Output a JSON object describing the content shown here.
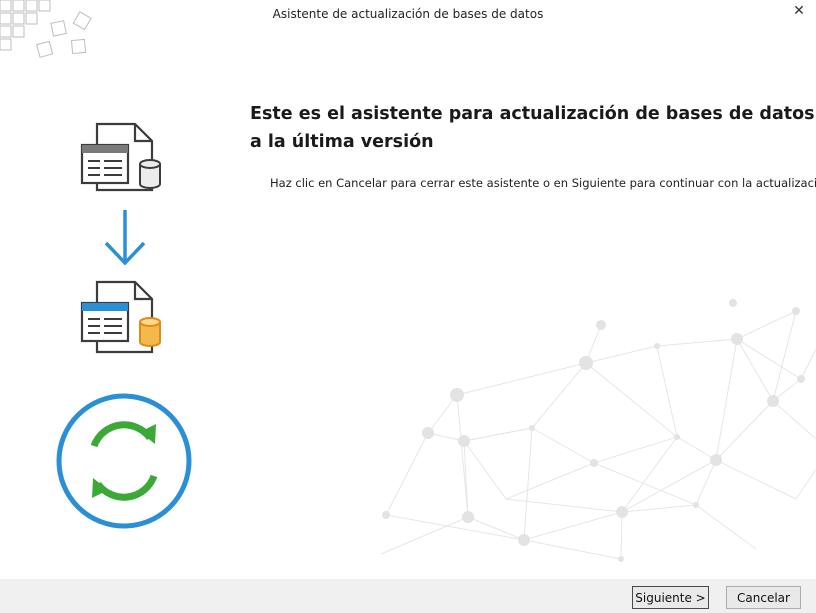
{
  "window": {
    "title": "Asistente de actualización de bases de datos",
    "close_symbol": "✕"
  },
  "content": {
    "heading_line1": "Este es el asistente para actualización de bases de datos",
    "heading_line2": "a la última versión",
    "instructions": "Haz clic en Cancelar para cerrar este asistente o en Siguiente para continuar con la actualización"
  },
  "footer": {
    "next_label": "Siguiente >",
    "cancel_label": "Cancelar"
  },
  "icons": {
    "source_db": "database-document-icon",
    "arrow": "arrow-down-icon",
    "target_db": "database-document-updated-icon",
    "refresh": "refresh-circle-icon"
  },
  "colors": {
    "accent_blue": "#2b8fd6",
    "refresh_green": "#3aa935",
    "db_orange": "#f5b94b"
  }
}
